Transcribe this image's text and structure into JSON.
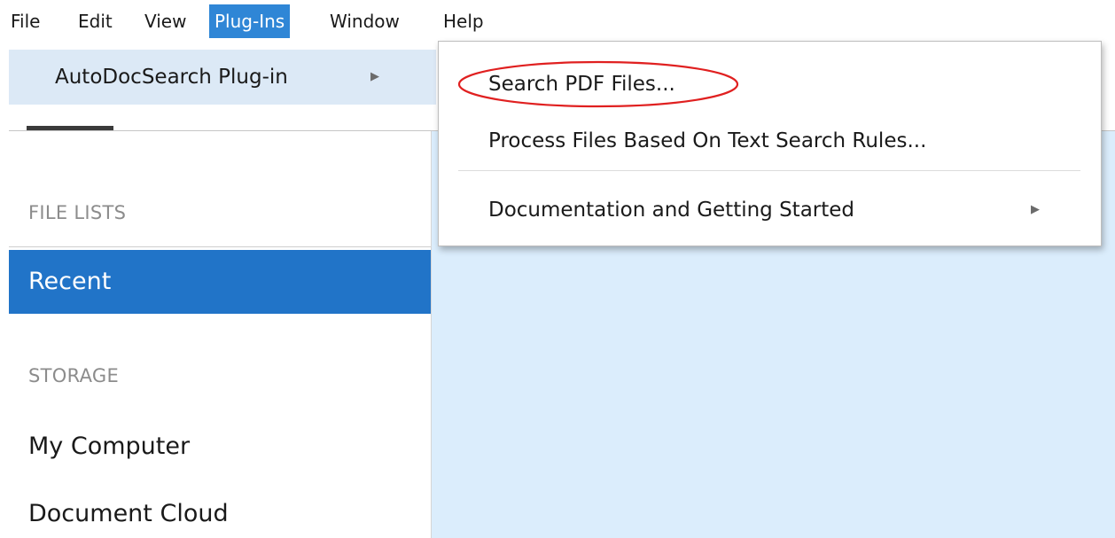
{
  "menubar": {
    "items": [
      {
        "label": "File"
      },
      {
        "label": "Edit"
      },
      {
        "label": "View"
      },
      {
        "label": "Plug-Ins",
        "active": true
      },
      {
        "label": "Window"
      },
      {
        "label": "Help"
      }
    ]
  },
  "plugin_submenu": {
    "label": "AutoDocSearch Plug-in"
  },
  "dropdown": {
    "items": [
      {
        "label": "Search PDF Files...",
        "highlighted": true
      },
      {
        "label": "Process Files Based On Text Search Rules..."
      },
      {
        "label": "Documentation and Getting Started",
        "has_submenu": true
      }
    ]
  },
  "sidebar": {
    "file_lists_header": "FILE LISTS",
    "recent_label": "Recent",
    "storage_header": "STORAGE",
    "my_computer_label": "My Computer",
    "document_cloud_label": "Document Cloud"
  },
  "colors": {
    "menu_active_bg": "#2f86d6",
    "submenu_strip_bg": "#dce9f6",
    "sidebar_selected_bg": "#2174c8",
    "content_pane_bg": "#dbedfc",
    "highlight_ellipse": "#e02020"
  },
  "icons": {
    "submenu_arrow": "chevron-right-icon"
  }
}
